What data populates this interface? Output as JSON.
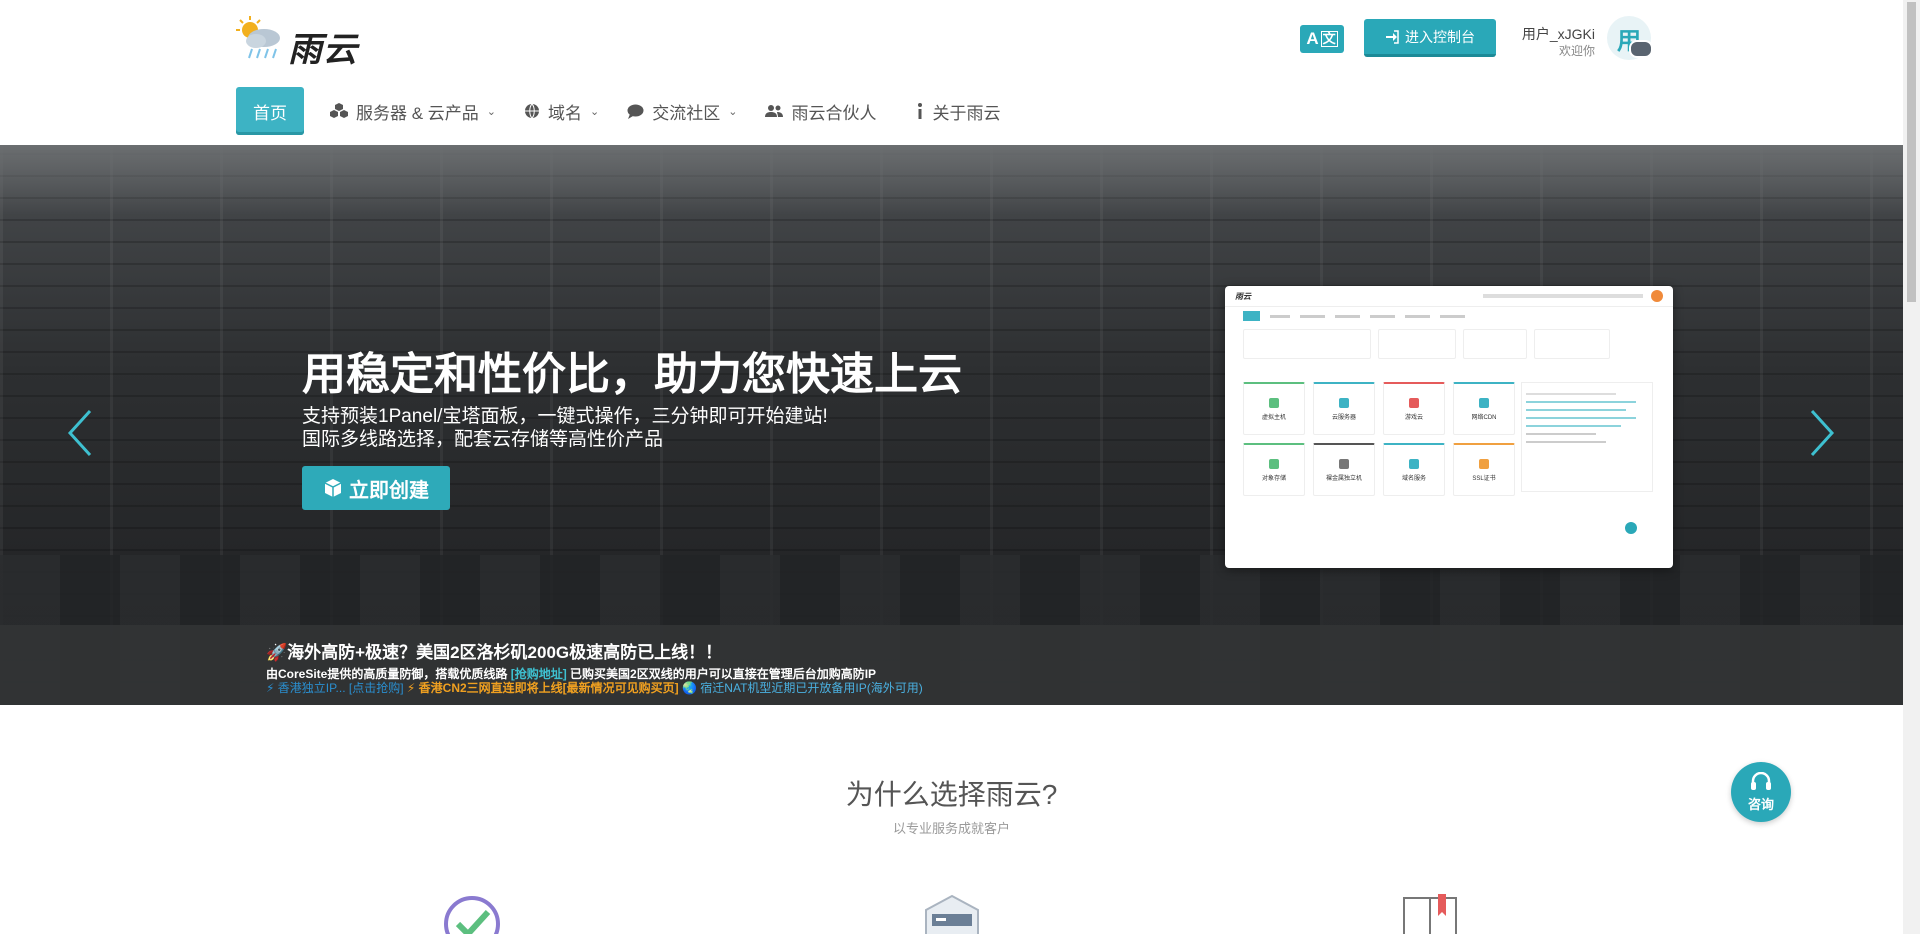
{
  "header": {
    "logo_text": "雨云",
    "lang_icon": "translate-icon",
    "lang_a": "A",
    "lang_zh": "文",
    "console_label": "进入控制台",
    "user_name": "用户_xJGKi",
    "user_welcome": "欢迎你",
    "avatar_text": "用"
  },
  "nav": {
    "items": [
      {
        "label": "首页",
        "icon": "home"
      },
      {
        "label": "服务器 & 云产品",
        "icon": "cubes-icon"
      },
      {
        "label": "域名",
        "icon": "globe-icon"
      },
      {
        "label": "交流社区",
        "icon": "comment-icon"
      },
      {
        "label": "雨云合伙人",
        "icon": "users-icon"
      },
      {
        "label": "关于雨云",
        "icon": "info-icon"
      }
    ]
  },
  "hero": {
    "title": "用稳定和性价比，助力您快速上云",
    "sub1": "支持预装1Panel/宝塔面板，一键式操作，三分钟即可开始建站!",
    "sub2": "国际多线路选择，配套云存储等高性价产品",
    "create_label": "立即创建"
  },
  "mock": {
    "logo": "雨云",
    "tiles": [
      "虚拟主机",
      "云服务器",
      "游戏云",
      "网络CDN",
      "对象存储",
      "裸金属独立机",
      "域名服务",
      "SSL证书"
    ]
  },
  "notice": {
    "title": "🚀海外高防+极速？美国2区洛杉矶200G极速高防已上线！！",
    "line_a": "由CoreSite提供的高质量防御，搭载优质线路",
    "line_link": "[抢购地址]",
    "line_b": "已购买美国2区双线的用户可以直接在管理后台加购高防IP",
    "tag1": "⚡ 香港独立IP... [点击抢购]",
    "tag2": "⚡ 香港CN2三网直连即将上线[最新情况可见购买页]",
    "tag3": "🌏 宿迁NAT机型近期已开放备用IP(海外可用)"
  },
  "why": {
    "title": "为什么选择雨云?",
    "subtitle": "以专业服务成就客户"
  },
  "consult": {
    "label": "咨询"
  }
}
